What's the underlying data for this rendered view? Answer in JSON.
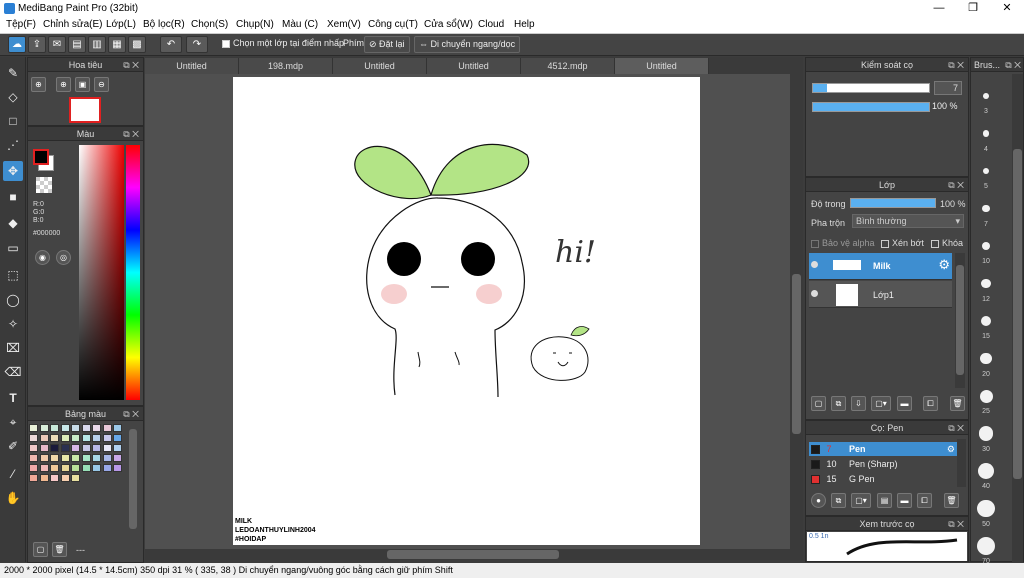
{
  "window": {
    "title": "MediBang Paint Pro (32bit)",
    "min": "—",
    "max": "❐",
    "close": "✕"
  },
  "menu": [
    "Tệp(F)",
    "Chỉnh sửa(E)",
    "Lớp(L)",
    "Bộ lọc(R)",
    "Chọn(S)",
    "Chụp(N)",
    "Màu (C)",
    "Xem(V)",
    "Công cụ(T)",
    "Cửa sổ(W)",
    "Cloud",
    "Help"
  ],
  "toolbar": {
    "snap_label": "Chọn một lớp tại điểm nhấp",
    "key_label": "Phím",
    "reset_label": "Đặt lại",
    "move_label": "Di chuyển ngang/dọc"
  },
  "navigator": {
    "title": "Hoa tiêu"
  },
  "color": {
    "title": "Màu",
    "r": "R:0",
    "g": "G:0",
    "b": "B:0",
    "hex": "#000000",
    "primary": "#000000",
    "secondary": "#ffffff"
  },
  "palette": {
    "title": "Bảng màu",
    "footer": "---",
    "colors": [
      "#e9f0d8",
      "#d8ecd8",
      "#c8e8d8",
      "#c8e8e8",
      "#c8dce8",
      "#d8d8ec",
      "#e8d8e8",
      "#e8c8d8",
      "#9cc8e8",
      "#ecd8d8",
      "#ecc8b8",
      "#ecdcb8",
      "#dcecb8",
      "#c8ecc8",
      "#b8e8e8",
      "#b8d0ec",
      "#c8c8ec",
      "#68a8e8",
      "#f0c8c8",
      "#e8b8c8",
      "#1a1a3a",
      "#2a3050",
      "#d8b8e8",
      "#c8c8e8",
      "#b8b8e8",
      "#e8e8f8",
      "#b0d0f0",
      "#f0b8b0",
      "#f0c8a8",
      "#f0d8a8",
      "#e8e8a8",
      "#c8e8a8",
      "#a8e8c8",
      "#a8d8e8",
      "#a8b8e8",
      "#c8a8e8",
      "#f0a8a8",
      "#f0b8b8",
      "#f0c898",
      "#e8d898",
      "#b8e098",
      "#98e0b8",
      "#98c8e8",
      "#98a8e8",
      "#b898e8",
      "#f0a898",
      "#f0b890",
      "#f8c8c8",
      "#f8d0b0",
      "#e8e0a0"
    ]
  },
  "tabs": [
    "Untitled",
    "198.mdp",
    "Untitled",
    "Untitled",
    "4512.mdp",
    "Untitled"
  ],
  "canvas": {
    "hi_text": "hi!",
    "credit": [
      "MILK",
      "LEDOANTHUYLINH2004",
      "#HOIDAP"
    ]
  },
  "brush_control": {
    "title": "Kiểm soát cọ",
    "size_value": "7",
    "opacity_value": "100 %",
    "size_fraction": 0.12,
    "opacity_fraction": 1.0
  },
  "layers": {
    "title": "Lớp",
    "opacity_label": "Độ trong",
    "opacity_value": "100 %",
    "blend_label": "Pha trộn",
    "blend_value": "Bình thường",
    "protect_alpha": "Bảo vệ alpha",
    "clip": "Xén bớt",
    "lock": "Khóa",
    "items": [
      {
        "name": "Milk",
        "selected": true
      },
      {
        "name": "Lớp1",
        "selected": false
      }
    ]
  },
  "pens": {
    "title": "Cọ: Pen",
    "items": [
      {
        "size": "7",
        "name": "Pen",
        "color": "#1a1a1a",
        "selected": true
      },
      {
        "size": "10",
        "name": "Pen (Sharp)",
        "color": "#1a1a1a",
        "selected": false
      },
      {
        "size": "15",
        "name": "G Pen",
        "color": "#e03030",
        "selected": false
      }
    ]
  },
  "preview": {
    "title": "Xem trước cọ",
    "size_text": "0.5 1n"
  },
  "brush_sizes": {
    "title": "Brus...",
    "sizes": [
      "3",
      "4",
      "5",
      "7",
      "10",
      "12",
      "15",
      "20",
      "25",
      "30",
      "40",
      "50",
      "70"
    ]
  },
  "status": {
    "text": "2000 * 2000 pixel  (14.5 * 14.5cm)  350 dpi  31 %  ( 335, 38 )  Di chuyển ngang/vuông góc bằng cách giữ phím Shift"
  }
}
